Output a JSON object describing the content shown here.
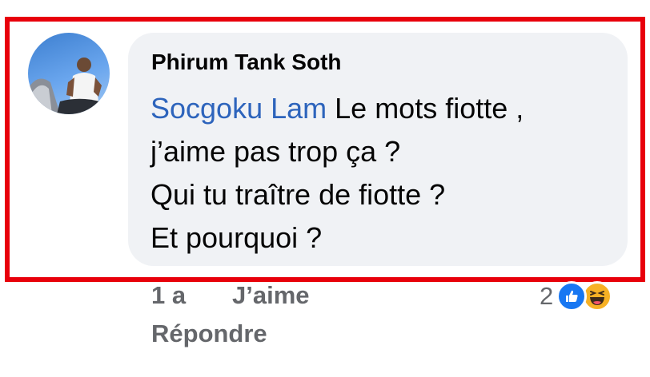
{
  "comment": {
    "author": "Phirum Tank Soth",
    "mention": "Socgoku Lam",
    "lines": [
      " Le mots fiotte ,",
      "j’aime pas trop ça ?",
      "Qui tu traître de fiotte ?",
      "Et pourquoi ?"
    ]
  },
  "meta": {
    "age": "1 a",
    "like_label": "J’aime",
    "reply_label": "Répondre",
    "reaction_count": "2",
    "reaction_icons": [
      "like-icon",
      "haha-icon"
    ]
  },
  "colors": {
    "highlight_frame": "#e8000b",
    "bubble": "#f0f2f5",
    "mention": "#2d64bc",
    "meta_text": "#65676b",
    "like_blue": "#1877f2",
    "haha_yellow": "#f7b125"
  }
}
